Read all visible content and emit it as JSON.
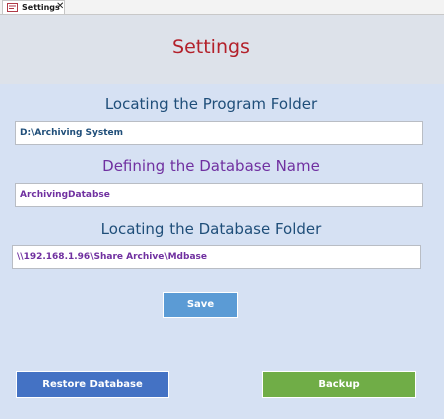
{
  "tab": {
    "label": "Settings",
    "icon": "form-icon",
    "close_glyph": "✕"
  },
  "form": {
    "title": "Settings",
    "sections": [
      {
        "label": "Locating the Program Folder",
        "value": "D:\\Archiving System"
      },
      {
        "label": "Defining the Database Name",
        "value": "ArchivingDatabse"
      },
      {
        "label": "Locating the Database Folder",
        "value": "\\\\192.168.1.96\\Share Archive\\Mdbase"
      }
    ]
  },
  "buttons": {
    "save": "Save",
    "restore": "Restore Database",
    "backup": "Backup"
  },
  "colors": {
    "background": "#d6e1f3",
    "header_background": "#dde2ea",
    "title": "#b3202a",
    "program_folder_label": "#1f4e79",
    "database_label": "#7030a0",
    "save_button": "#5b9bd5",
    "restore_button": "#4472c4",
    "backup_button": "#70ad47"
  }
}
